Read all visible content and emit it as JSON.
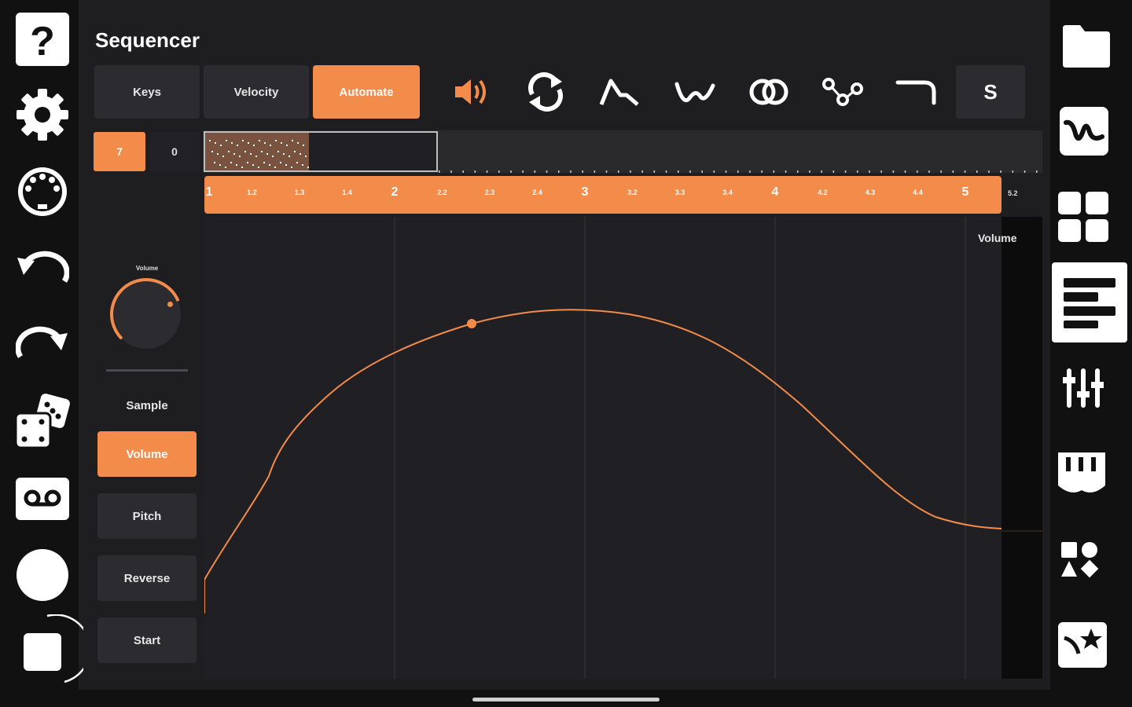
{
  "app": {
    "title": "Sequencer"
  },
  "colors": {
    "accent": "#f38b4a",
    "panel": "#1e1e21",
    "button": "#2c2c30"
  },
  "left_rail": [
    {
      "name": "help-icon"
    },
    {
      "name": "settings-icon"
    },
    {
      "name": "midi-icon"
    },
    {
      "name": "undo-icon"
    },
    {
      "name": "redo-icon"
    },
    {
      "name": "dice-icon"
    },
    {
      "name": "tape-icon"
    },
    {
      "name": "record-icon"
    },
    {
      "name": "stop-icon"
    }
  ],
  "right_rail": [
    {
      "name": "folder-icon"
    },
    {
      "name": "waveform-icon"
    },
    {
      "name": "grid-icon"
    },
    {
      "name": "piano-roll-icon",
      "active": true
    },
    {
      "name": "mixer-icon"
    },
    {
      "name": "keyboard-icon"
    },
    {
      "name": "shapes-icon"
    },
    {
      "name": "effects-icon"
    }
  ],
  "tabs": [
    {
      "label": "Keys",
      "active": false
    },
    {
      "label": "Velocity",
      "active": false
    },
    {
      "label": "Automate",
      "active": true
    }
  ],
  "tools": [
    {
      "name": "speaker-icon",
      "active": true
    },
    {
      "name": "loop-icon"
    },
    {
      "name": "attack-decay-icon"
    },
    {
      "name": "smooth-curve-icon"
    },
    {
      "name": "overlap-icon"
    },
    {
      "name": "nodes-icon"
    },
    {
      "name": "ramp-icon"
    }
  ],
  "solo_button": {
    "label": "S"
  },
  "pattern": {
    "index_label": "7",
    "offset_label": "0"
  },
  "ruler": {
    "labels": [
      "1",
      "1.2",
      "1.3",
      "1.4",
      "2",
      "2.2",
      "2.3",
      "2.4",
      "3",
      "3.2",
      "3.3",
      "3.4",
      "4",
      "4.2",
      "4.3",
      "4.4",
      "5"
    ],
    "overflow_label": "5.2"
  },
  "automation": {
    "lane_label": "Volume",
    "knob_label": "Volume",
    "knob_value": 0.75,
    "section_label": "Sample",
    "params": [
      {
        "label": "Volume",
        "active": true
      },
      {
        "label": "Pitch",
        "active": false
      },
      {
        "label": "Reverse",
        "active": false
      },
      {
        "label": "Start",
        "active": false
      }
    ]
  }
}
